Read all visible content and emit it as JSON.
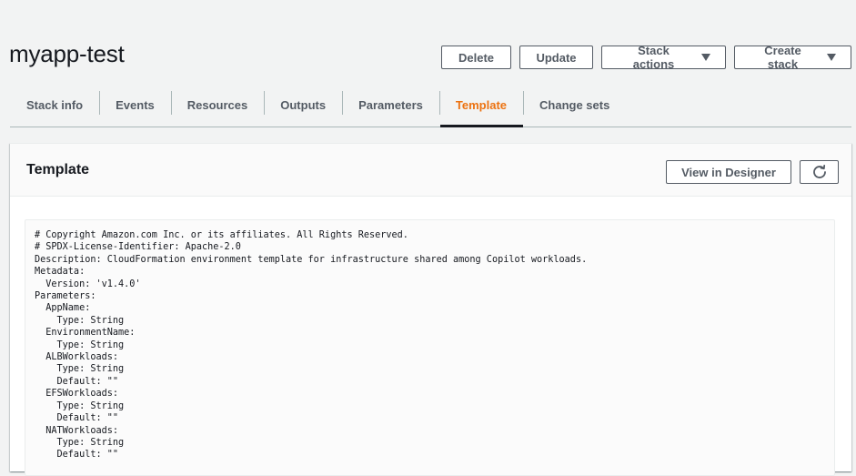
{
  "stack": {
    "name": "myapp-test"
  },
  "actions": {
    "delete": "Delete",
    "update": "Update",
    "stack_actions": "Stack actions",
    "create_stack": "Create stack"
  },
  "tabs": [
    {
      "label": "Stack info"
    },
    {
      "label": "Events"
    },
    {
      "label": "Resources"
    },
    {
      "label": "Outputs"
    },
    {
      "label": "Parameters"
    },
    {
      "label": "Template",
      "active": true
    },
    {
      "label": "Change sets"
    }
  ],
  "template_panel": {
    "title": "Template",
    "view_in_designer": "View in Designer",
    "refresh_icon": "refresh-icon",
    "lines": [
      "# Copyright Amazon.com Inc. or its affiliates. All Rights Reserved.",
      "# SPDX-License-Identifier: Apache-2.0",
      "Description: CloudFormation environment template for infrastructure shared among Copilot workloads.",
      "Metadata:",
      "  Version: 'v1.4.0'",
      "Parameters:",
      "  AppName:",
      "    Type: String",
      "  EnvironmentName:",
      "    Type: String",
      "  ALBWorkloads:",
      "    Type: String",
      "    Default: \"\"",
      "  EFSWorkloads:",
      "    Type: String",
      "    Default: \"\"",
      "  NATWorkloads:",
      "    Type: String",
      "    Default: \"\""
    ]
  },
  "colors": {
    "accent": "#ec7211",
    "text": "#16191f",
    "button_border": "#545b64",
    "page_background": "#f2f3f3"
  }
}
